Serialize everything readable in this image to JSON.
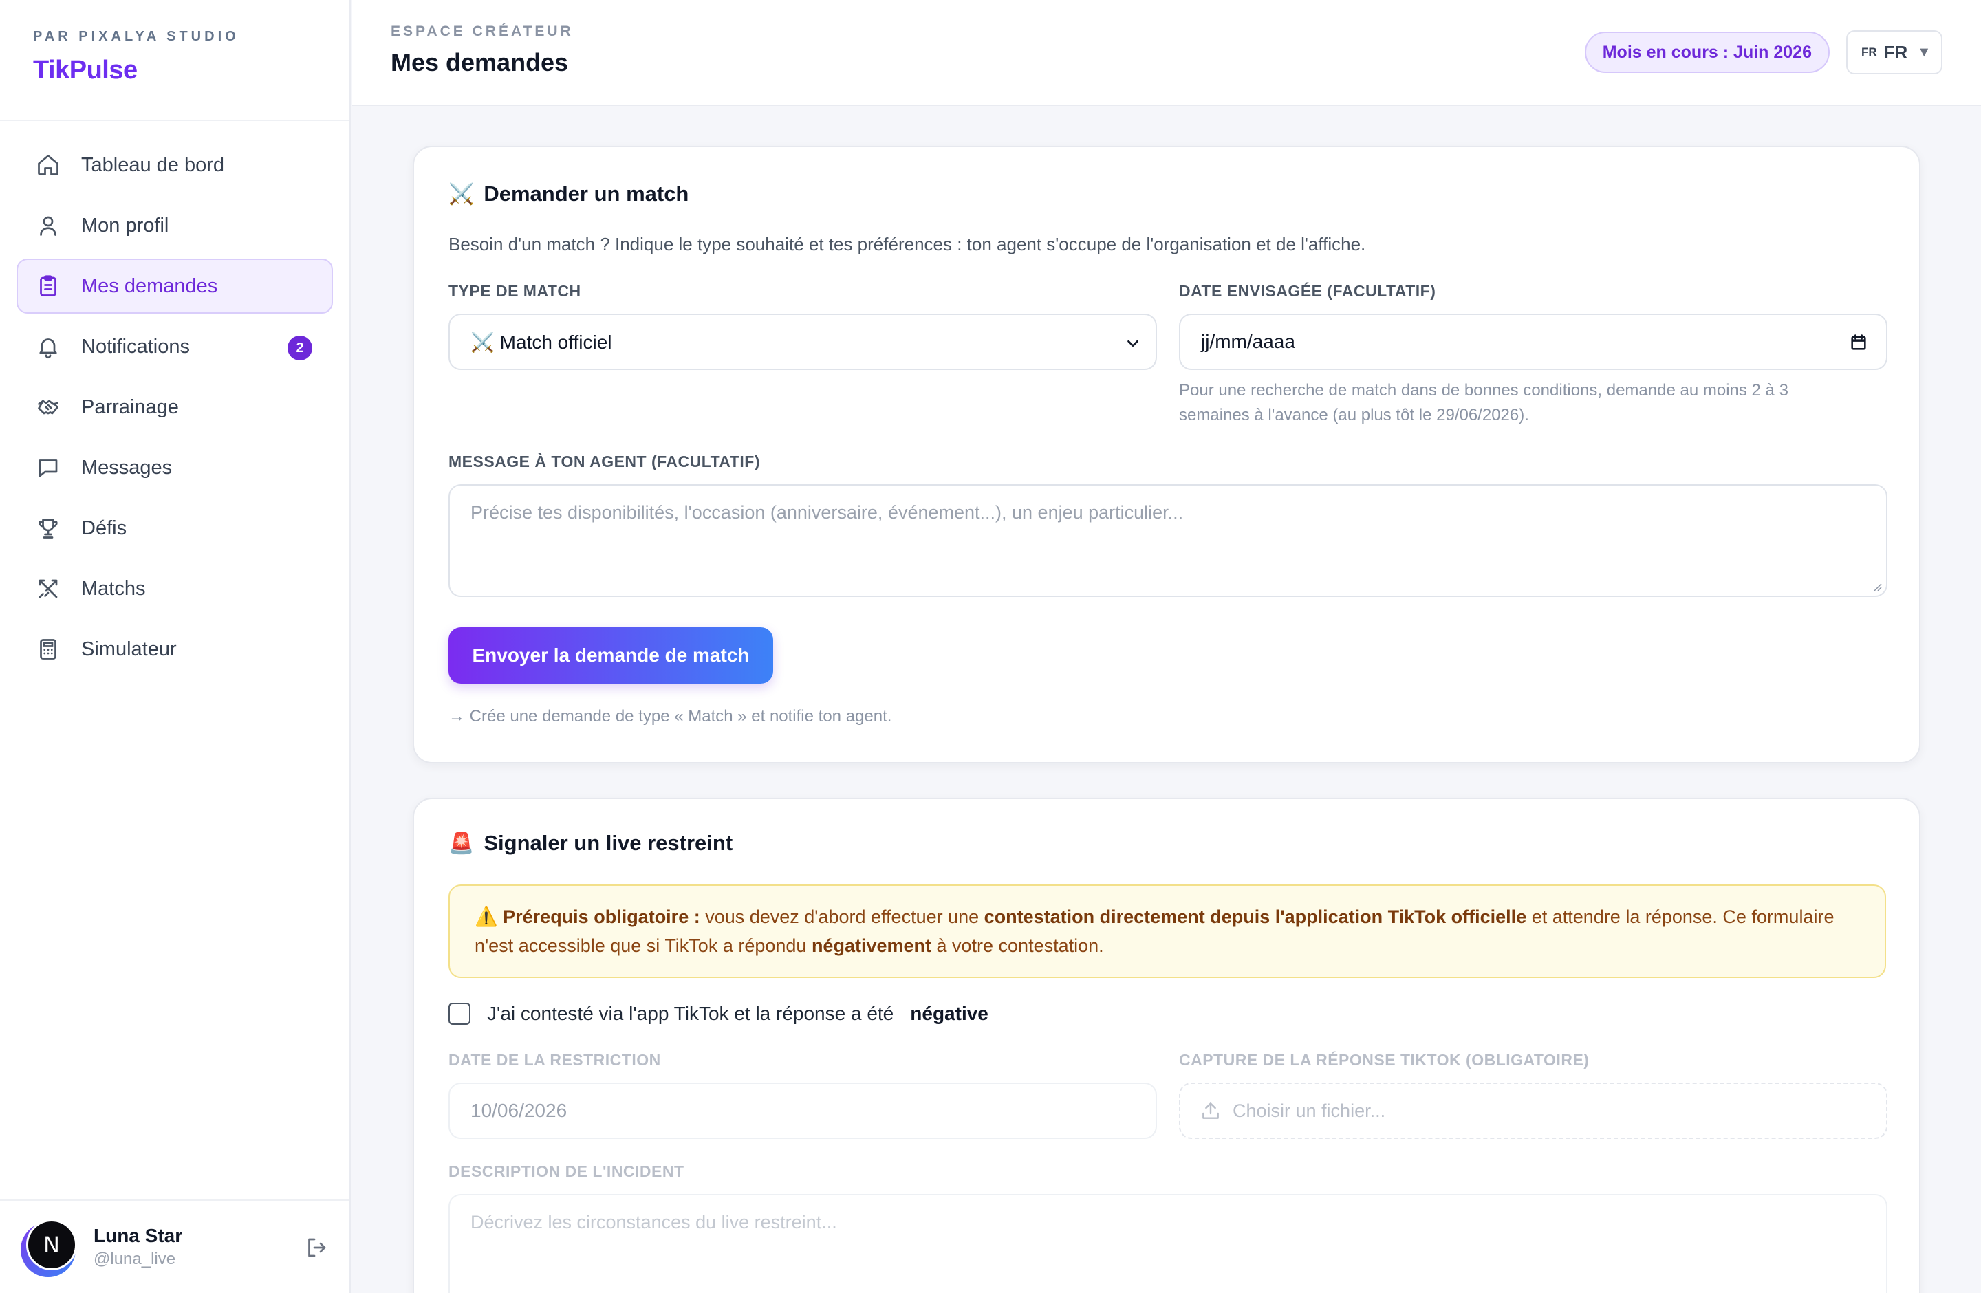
{
  "sidebar": {
    "kicker": "PAR PIXALYA STUDIO",
    "logo": "TikPulse",
    "items": [
      {
        "label": "Tableau de bord",
        "icon": "home-icon"
      },
      {
        "label": "Mon profil",
        "icon": "user-icon"
      },
      {
        "label": "Mes demandes",
        "icon": "clipboard-icon",
        "active": true
      },
      {
        "label": "Notifications",
        "icon": "bell-icon",
        "badge": "2"
      },
      {
        "label": "Parrainage",
        "icon": "handshake-icon"
      },
      {
        "label": "Messages",
        "icon": "message-icon"
      },
      {
        "label": "Défis",
        "icon": "trophy-icon"
      },
      {
        "label": "Matchs",
        "icon": "swords-icon"
      },
      {
        "label": "Simulateur",
        "icon": "calculator-icon"
      }
    ],
    "user": {
      "initial": "N",
      "name": "Luna Star",
      "handle": "@luna_live"
    }
  },
  "header": {
    "kicker": "ESPACE CRÉATEUR",
    "title": "Mes demandes",
    "month_pill": "Mois en cours : Juin 2026",
    "lang_flag": "FR",
    "lang": "FR",
    "lang_caret": "▼"
  },
  "match": {
    "emoji": "⚔️",
    "title": "Demander un match",
    "description": "Besoin d'un match ? Indique le type souhaité et tes préférences : ton agent s'occupe de l'organisation et de l'affiche.",
    "type_label": "TYPE DE MATCH",
    "type_value": "⚔️ Match officiel",
    "date_label": "DATE ENVISAGÉE (FACULTATIF)",
    "date_placeholder": "jj/mm/aaaa",
    "date_hint_1": "Pour une recherche de match dans de bonnes conditions, demande au moins 2 à 3",
    "date_hint_2": "semaines à l'avance (au plus tôt le 29/06/2026).",
    "message_label": "MESSAGE À TON AGENT (FACULTATIF)",
    "message_placeholder": "Précise tes disponibilités, l'occasion (anniversaire, événement...), un enjeu particulier...",
    "submit": "Envoyer la demande de match",
    "note": "→ Crée une demande de type « Match » et notifie ton agent."
  },
  "restricted": {
    "emoji": "🚨",
    "title": "Signaler un live restreint",
    "warn_icon": "⚠️",
    "warn_bold_1": "Prérequis obligatoire :",
    "warn_text_1": " vous devez d'abord effectuer une ",
    "warn_bold_2": "contestation directement depuis l'application TikTok officielle",
    "warn_text_2": " et attendre la réponse. Ce formulaire n'est accessible que si TikTok a répondu ",
    "warn_bold_3": "négativement",
    "warn_text_3": " à votre contestation.",
    "check_label": "J'ai contesté via l'app TikTok et la réponse a été",
    "check_bold": "négative",
    "date_label": "DATE DE LA RESTRICTION",
    "date_value": "10/06/2026",
    "capture_label": "CAPTURE DE LA RÉPONSE TIKTOK (OBLIGATOIRE)",
    "capture_placeholder": "Choisir un fichier...",
    "incident_label": "DESCRIPTION DE L'INCIDENT",
    "incident_placeholder": "Décrivez les circonstances du live restreint..."
  }
}
